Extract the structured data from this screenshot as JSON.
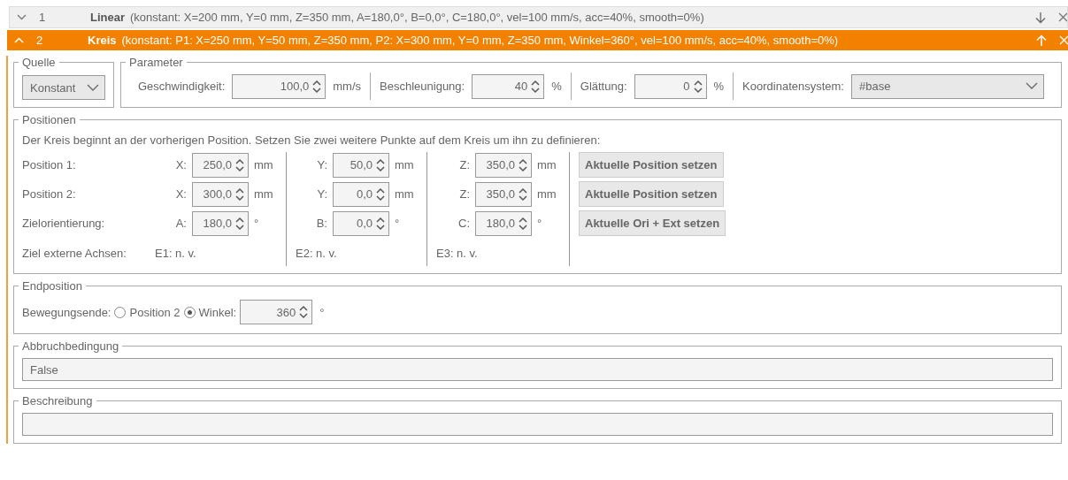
{
  "steps": [
    {
      "number": "1",
      "name": "Linear",
      "summary": "(konstant: X=200 mm, Y=0 mm, Z=350 mm, A=180,0°, B=0,0°, C=180,0°, vel=100 mm/s, acc=40%, smooth=0%)",
      "expanded": false
    },
    {
      "number": "2",
      "name": "Kreis",
      "summary": "(konstant: P1: X=250 mm, Y=50 mm, Z=350 mm, P2: X=300 mm, Y=0 mm, Z=350 mm, Winkel=360°, vel=100 mm/s, acc=40%, smooth=0%)",
      "expanded": true
    }
  ],
  "source": {
    "legend": "Quelle",
    "value": "Konstant"
  },
  "parameter": {
    "legend": "Parameter",
    "fields": [
      {
        "label": "Geschwindigkeit:",
        "value": "100,0",
        "unit": "mm/s"
      },
      {
        "label": "Beschleunigung:",
        "value": "40",
        "unit": "%"
      },
      {
        "label": "Glättung:",
        "value": "0",
        "unit": "%"
      }
    ],
    "coordinate_system": {
      "label": "Koordinatensystem:",
      "value": "#base"
    }
  },
  "positions": {
    "legend": "Positionen",
    "description": "Der Kreis beginnt an der vorherigen Position. Setzen Sie zwei weitere Punkte auf dem Kreis um ihn zu definieren:",
    "rows": [
      {
        "label": "Position 1:",
        "fields": [
          {
            "axis": "X:",
            "value": "250,0",
            "unit": "mm"
          },
          {
            "axis": "Y:",
            "value": "50,0",
            "unit": "mm"
          },
          {
            "axis": "Z:",
            "value": "350,0",
            "unit": "mm"
          }
        ],
        "button": "Aktuelle Position setzen"
      },
      {
        "label": "Position 2:",
        "fields": [
          {
            "axis": "X:",
            "value": "300,0",
            "unit": "mm"
          },
          {
            "axis": "Y:",
            "value": "0,0",
            "unit": "mm"
          },
          {
            "axis": "Z:",
            "value": "350,0",
            "unit": "mm"
          }
        ],
        "button": "Aktuelle Position setzen"
      },
      {
        "label": "Zielorientierung:",
        "fields": [
          {
            "axis": "A:",
            "value": "180,0",
            "unit": "°"
          },
          {
            "axis": "B:",
            "value": "0,0",
            "unit": "°"
          },
          {
            "axis": "C:",
            "value": "180,0",
            "unit": "°"
          }
        ],
        "button": "Aktuelle Ori + Ext setzen"
      }
    ],
    "external": {
      "label": "Ziel externe Achsen:",
      "values": [
        "E1: n. v.",
        "E2: n. v.",
        "E3: n. v."
      ]
    }
  },
  "end_position": {
    "legend": "Endposition",
    "label": "Bewegungsende:",
    "options": [
      {
        "label": "Position 2",
        "selected": false
      },
      {
        "label": "Winkel:",
        "selected": true
      }
    ],
    "angle": {
      "value": "360",
      "unit": "°"
    }
  },
  "abort_condition": {
    "legend": "Abbruchbedingung",
    "value": "False"
  },
  "description": {
    "legend": "Beschreibung"
  }
}
